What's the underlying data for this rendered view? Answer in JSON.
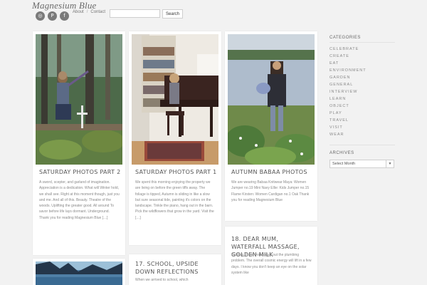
{
  "site": {
    "title": "Magnesium Blue"
  },
  "social": [
    {
      "icon": "instagram-icon",
      "glyph": "◎"
    },
    {
      "icon": "pinterest-icon",
      "glyph": "P"
    },
    {
      "icon": "facebook-icon",
      "glyph": "f"
    }
  ],
  "nav": {
    "about": "About",
    "separator": "/",
    "contact": "Contact"
  },
  "search": {
    "value": "",
    "placeholder": "",
    "button_label": "Search"
  },
  "posts": [
    {
      "title": "SATURDAY PHOTOS PART 2",
      "excerpt": "A sword, scepter, and garland of imagination. Appreciation is a dedication. What will Winter hold, we shall see. Right at this moment though, just you and me. And all of this. Beauty. Theatre of the woods. Uplifting the greater good. All around To savor before life lays dormant. Underground. Thank you for reading Magnesium Blue […]"
    },
    {
      "title": "SATURDAY PHOTOS PART 1",
      "excerpt": "We spent this morning enjoying the property we are living on before the green tiffs away. The foliage is tipped, Autumn is sliding in like a slow but sure seasonal tide, painting it's colors on the landscape. Tinkle the piano, hang out in the barn. Pick the wildflowers that grow in the yard. Visit the […]"
    },
    {
      "title": "AUTUMN BABAA PHOTOS",
      "excerpt": "We are wearing Babaa Knitwear Maya: Women Jumper no.19 Mini Navy Ellie: Kids Jumper no.15 Flame Kirsten: Women Cardigan no.1 Oak Thank you for reading Magnesium Blue"
    },
    {
      "title": "17. SCHOOL, UPSIDE DOWN REFLECTIONS",
      "excerpt": "When we arrived to school, which"
    },
    {
      "title": "18. DEAR MUM, WATERFALL MASSAGE, GOLDEN MILK",
      "excerpt": "Hi Mum, Hope you sorted out the plumbing problem. The overall cosmic energy will lift in a few days. I know you don't keep an eye on the solar system like"
    }
  ],
  "sidebar": {
    "categories_title": "CATEGORIES",
    "categories": [
      "CELEBRATE",
      "CREATE",
      "EAT",
      "ENVIRONMENT",
      "GARDEN",
      "GENERAL",
      "INTERVIEW",
      "LEARN",
      "OBJECT",
      "PLAY",
      "TRAVEL",
      "VISIT",
      "WEAR"
    ],
    "archives_title": "ARCHIVES",
    "archives_selected": "Select Month"
  }
}
